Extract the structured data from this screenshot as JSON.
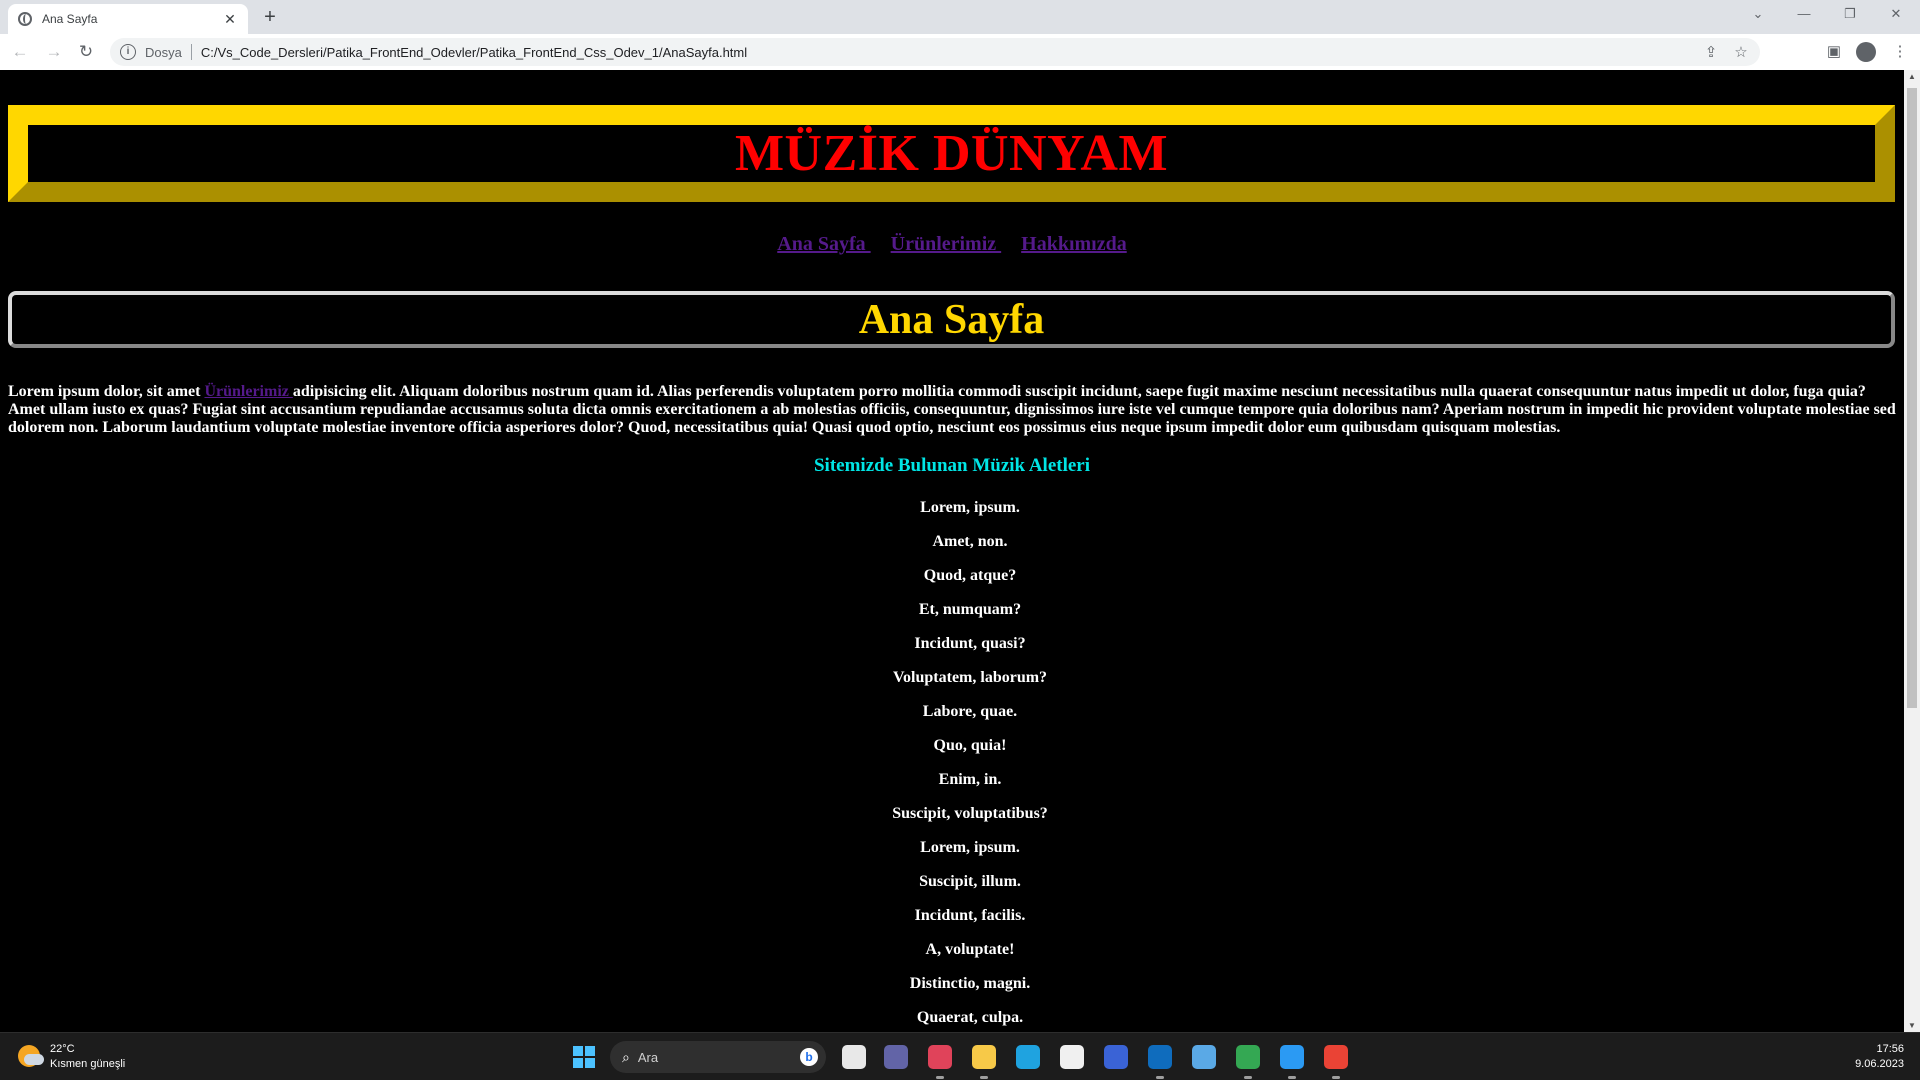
{
  "browser": {
    "tab_title": "Ana Sayfa",
    "tab_close": "✕",
    "new_tab": "+",
    "scheme_label": "Dosya",
    "url": "C:/Vs_Code_Dersleri/Patika_FrontEnd_Odevler/Patika_FrontEnd_Css_Odev_1/AnaSayfa.html"
  },
  "page": {
    "site_title": "MÜZİK DÜNYAM",
    "nav": [
      "Ana Sayfa ",
      "Ürünlerimiz ",
      "Hakkımızda"
    ],
    "section_title": "Ana Sayfa",
    "intro_before": "Lorem ipsum dolor, sit amet ",
    "intro_link": "Ürünlerimiz ",
    "intro_after": "adipisicing elit. Aliquam doloribus nostrum quam id. Alias perferendis voluptatem porro mollitia commodi suscipit incidunt, saepe fugit maxime nesciunt necessitatibus nulla quaerat consequuntur natus impedit ut dolor, fuga quia? Amet ullam iusto ex quas? Fugiat sint accusantium repudiandae accusamus soluta dicta omnis exercitationem a ab molestias officiis, consequuntur, dignissimos iure iste vel cumque tempore quia doloribus nam? Aperiam nostrum in impedit hic provident voluptate molestiae sed dolorem non. Laborum laudantium voluptate molestiae inventore officia asperiores dolor? Quod, necessitatibus quia! Quasi quod optio, nesciunt eos possimus eius neque ipsum impedit dolor eum quibusdam quisquam molestias.",
    "instruments_heading": "Sitemizde Bulunan Müzik Aletleri",
    "instruments": [
      "Lorem, ipsum.",
      "Amet, non.",
      "Quod, atque?",
      "Et, numquam?",
      "Incidunt, quasi?",
      "Voluptatem, laborum?",
      "Labore, quae.",
      "Quo, quia!",
      "Enim, in.",
      "Suscipit, voluptatibus?",
      "Lorem, ipsum.",
      "Suscipit, illum.",
      "Incidunt, facilis.",
      "A, voluptate!",
      "Distinctio, magni.",
      "Quaerat, culpa."
    ]
  },
  "taskbar": {
    "weather_temp": "22°C",
    "weather_desc": "Kısmen güneşli",
    "search_placeholder": "Ara",
    "time": "17:56",
    "date": "9.06.2023",
    "apps": [
      {
        "name": "task-view-icon",
        "color": "#e8e8e8"
      },
      {
        "name": "teams-icon",
        "color": "#6264a7"
      },
      {
        "name": "snipping-tool-icon",
        "color": "#e0435a"
      },
      {
        "name": "file-explorer-icon",
        "color": "#f7c948"
      },
      {
        "name": "edge-icon",
        "color": "#1fa3e0"
      },
      {
        "name": "microsoft-store-icon",
        "color": "#f0f0f0"
      },
      {
        "name": "power-automate-icon",
        "color": "#3a63d6"
      },
      {
        "name": "outlook-icon",
        "color": "#0f6cbd"
      },
      {
        "name": "remote-desktop-icon",
        "color": "#5aa9e6"
      },
      {
        "name": "chrome-icon",
        "color": "#34a853"
      },
      {
        "name": "vscode-icon",
        "color": "#2b9af3"
      },
      {
        "name": "chrome-icon",
        "color": "#ea4335"
      }
    ]
  },
  "colors": {
    "title_red": "#ff0000",
    "gold": "#ffd700",
    "link_purple": "#551a8b",
    "heading_cyan": "#00e5e5"
  }
}
